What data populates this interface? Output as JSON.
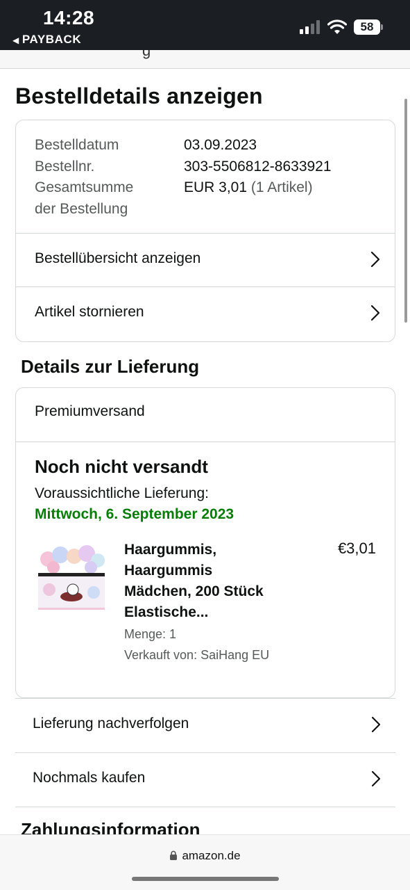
{
  "status_bar": {
    "time": "14:28",
    "back_label": "PAYBACK",
    "battery": "58"
  },
  "page": {
    "title": "Bestelldetails anzeigen"
  },
  "order_summary": {
    "labels": [
      "Bestelldatum",
      "Bestellnr.",
      "Gesamtsumme",
      "der Bestellung"
    ],
    "order_date": "03.09.2023",
    "order_number": "303-5506812-8633921",
    "total": "EUR 3,01",
    "item_count": "(1 Artikel)",
    "view_summary_label": "Bestellübersicht anzeigen",
    "cancel_label": "Artikel stornieren"
  },
  "delivery": {
    "section_title": "Details zur Lieferung",
    "shipping_method": "Premiumversand",
    "status": "Noch nicht versandt",
    "eta_label": "Voraussichtliche Lieferung:",
    "eta_date": "Mittwoch, 6. September 2023",
    "product": {
      "title_lines": [
        "Haargummis,",
        "Haargummis",
        "Mädchen, 200 Stück",
        "Elastische..."
      ],
      "price": "€3,01",
      "quantity": "Menge: 1",
      "seller": "Verkauft von: SaiHang EU"
    }
  },
  "actions": {
    "track_label": "Lieferung nachverfolgen",
    "buy_again_label": "Nochmals kaufen"
  },
  "next_section": {
    "title": "Zahlungsinformation"
  },
  "browser": {
    "url": "amazon.de"
  },
  "colors": {
    "status_bar_bg": "#1b1f24",
    "delivery_date_green": "#067d06",
    "border": "#d5d9d9"
  }
}
